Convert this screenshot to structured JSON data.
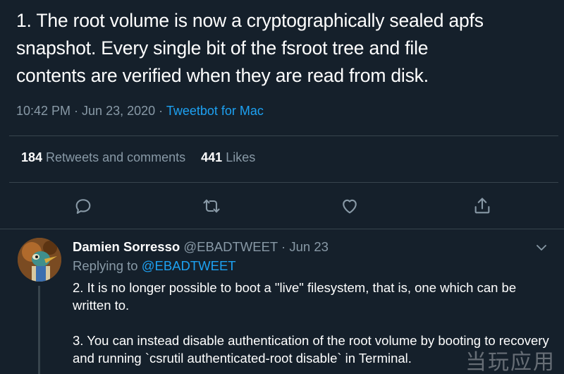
{
  "tweet": {
    "text": "1. The root volume is now a cryptographically sealed apfs\nsnapshot. Every single bit of the fsroot tree and file\ncontents are verified when they are read from disk.",
    "timestamp": "10:42 PM · Jun 23, 2020 · ",
    "client": "Tweetbot for Mac",
    "retweets_count": "184",
    "retweets_label": " Retweets and comments",
    "likes_count": "441",
    "likes_label": " Likes"
  },
  "actions": [
    {
      "icon": "reply-icon"
    },
    {
      "icon": "retweet-icon"
    },
    {
      "icon": "like-icon"
    },
    {
      "icon": "share-icon"
    }
  ],
  "reply": {
    "name": "Damien Sorresso",
    "handle": " @EBADTWEET",
    "date": " · Jun 23",
    "replying_prefix": "Replying to ",
    "replying_to": "@EBADTWEET",
    "paragraph1": "2. It is no longer possible to boot a \"live\" filesystem, that is, one which can be written to.",
    "paragraph2": "3. You can instead disable authentication of the root volume by booting to recovery and running `csrutil authenticated-root disable` in Terminal."
  },
  "watermark": "当玩应用",
  "colors": {
    "background": "#15202b",
    "text": "#ffffff",
    "muted": "#8899a6",
    "accent": "#1da1f2",
    "divider": "#38444d"
  }
}
